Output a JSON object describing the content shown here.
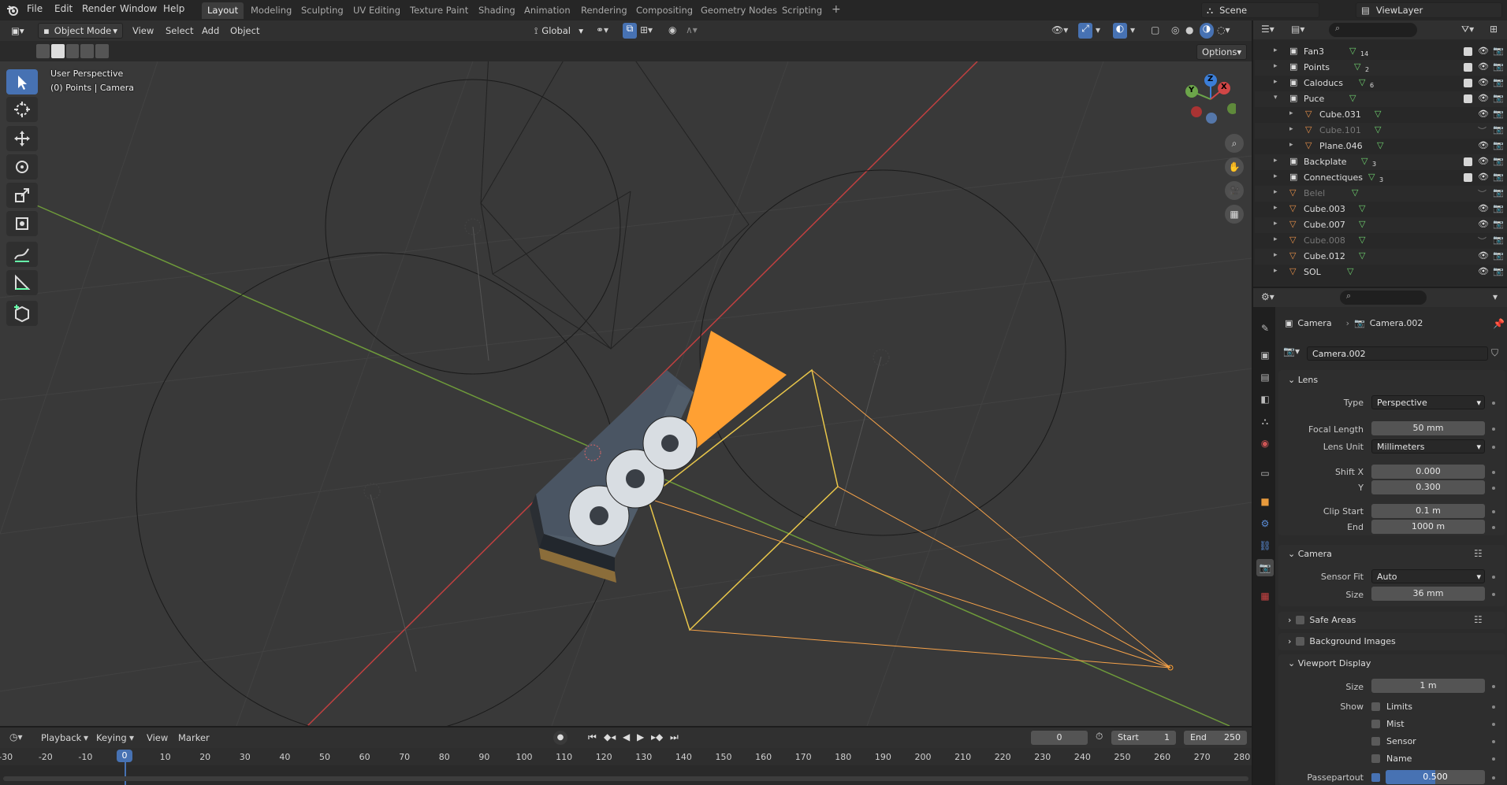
{
  "menubar": {
    "items": [
      "File",
      "Edit",
      "Render",
      "Window",
      "Help"
    ],
    "workspaces": [
      "Layout",
      "Modeling",
      "Sculpting",
      "UV Editing",
      "Texture Paint",
      "Shading",
      "Animation",
      "Rendering",
      "Compositing",
      "Geometry Nodes",
      "Scripting"
    ],
    "active_workspace": "Layout",
    "add_tab": "+",
    "scene": "Scene",
    "view_layer": "ViewLayer"
  },
  "viewport_header": {
    "mode": "Object Mode",
    "menus": [
      "View",
      "Select",
      "Add",
      "Object"
    ],
    "orientation": "Global",
    "options": "Options"
  },
  "viewport": {
    "perspective": "User Perspective",
    "context": "(0) Points | Camera",
    "gizmo_axes": {
      "x": "X",
      "y": "Y",
      "z": "Z"
    }
  },
  "outliner": {
    "rows": [
      {
        "name": "Fan3",
        "indent": 0,
        "dim": false,
        "checked": true,
        "badge": "14"
      },
      {
        "name": "Points",
        "indent": 0,
        "dim": false,
        "checked": true,
        "badge": "2"
      },
      {
        "name": "Caloducs",
        "indent": 0,
        "dim": false,
        "checked": true,
        "badge": "6"
      },
      {
        "name": "Puce",
        "indent": 0,
        "dim": false,
        "checked": true,
        "badge": ""
      },
      {
        "name": "Cube.031",
        "indent": 1,
        "dim": false,
        "checked": false,
        "badge": ""
      },
      {
        "name": "Cube.101",
        "indent": 1,
        "dim": true,
        "checked": false,
        "badge": ""
      },
      {
        "name": "Plane.046",
        "indent": 1,
        "dim": false,
        "checked": false,
        "badge": ""
      },
      {
        "name": "Backplate",
        "indent": 0,
        "dim": false,
        "checked": true,
        "badge": "3"
      },
      {
        "name": "Connectiques",
        "indent": 0,
        "dim": false,
        "checked": true,
        "badge": "3"
      },
      {
        "name": "Belel",
        "indent": 0,
        "dim": true,
        "checked": false,
        "badge": ""
      },
      {
        "name": "Cube.003",
        "indent": 0,
        "dim": false,
        "checked": false,
        "badge": ""
      },
      {
        "name": "Cube.007",
        "indent": 0,
        "dim": false,
        "checked": false,
        "badge": ""
      },
      {
        "name": "Cube.008",
        "indent": 0,
        "dim": true,
        "checked": false,
        "badge": ""
      },
      {
        "name": "Cube.012",
        "indent": 0,
        "dim": false,
        "checked": false,
        "badge": ""
      },
      {
        "name": "SOL",
        "indent": 0,
        "dim": false,
        "checked": false,
        "badge": ""
      }
    ]
  },
  "properties": {
    "breadcrumb": {
      "object": "Camera",
      "data": "Camera.002"
    },
    "datablock": "Camera.002",
    "lens": {
      "title": "Lens",
      "type_label": "Type",
      "type": "Perspective",
      "focal_label": "Focal Length",
      "focal": "50 mm",
      "unit_label": "Lens Unit",
      "unit": "Millimeters",
      "shiftx_label": "Shift X",
      "shiftx": "0.000",
      "shifty_label": "Y",
      "shifty": "0.300",
      "clipstart_label": "Clip Start",
      "clipstart": "0.1 m",
      "clipend_label": "End",
      "clipend": "1000 m"
    },
    "camera": {
      "title": "Camera",
      "sensorfit_label": "Sensor Fit",
      "sensorfit": "Auto",
      "size_label": "Size",
      "size": "36 mm"
    },
    "safe_areas": "Safe Areas",
    "background_images": "Background Images",
    "viewport_display": {
      "title": "Viewport Display",
      "size_label": "Size",
      "size": "1 m",
      "show_label": "Show",
      "limits": "Limits",
      "mist": "Mist",
      "sensor": "Sensor",
      "name": "Name",
      "passepartout_label": "Passepartout",
      "passepartout": "0.500",
      "passepartout_fill": 0.5
    }
  },
  "timeline": {
    "menus": [
      "Playback",
      "Keying",
      "View",
      "Marker"
    ],
    "current_frame": "0",
    "start_label": "Start",
    "start": "1",
    "end_label": "End",
    "end": "250",
    "playhead": "0",
    "ticks": [
      "-30",
      "-20",
      "-10",
      "10",
      "20",
      "30",
      "40",
      "50",
      "60",
      "70",
      "80",
      "90",
      "100",
      "110",
      "120",
      "130",
      "140",
      "150",
      "160",
      "170",
      "180",
      "190",
      "200",
      "210",
      "220",
      "230",
      "240",
      "250",
      "260",
      "270",
      "280"
    ]
  },
  "colors": {
    "accent": "#4772b3",
    "camera_orange": "#ffa033",
    "selection_yellow": "#e8c64a",
    "x_axis": "#c04040",
    "y_axis": "#6e9a3a"
  }
}
